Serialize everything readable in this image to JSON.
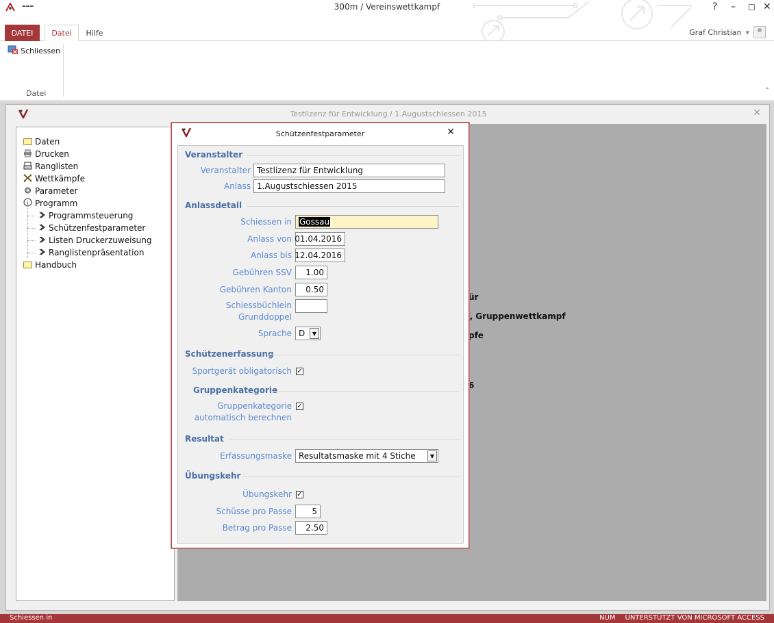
{
  "window": {
    "title": "300m / Vereinswettkampf",
    "help": "?",
    "minimize": "–",
    "restore": "☐",
    "close": "✕",
    "user": "Graf Christian",
    "user_dropdown": "▾"
  },
  "ribbon": {
    "tabs": [
      "DATEI",
      "Datei",
      "Hilfe"
    ],
    "button_label": "Schliessen",
    "group_label": "Datei",
    "collapse": "⌃"
  },
  "document": {
    "title": "Testlizenz für Entwicklung  /  1.Augustschiessen 2015",
    "close": "✕"
  },
  "tree": {
    "items": [
      {
        "label": "Daten",
        "icon": "folder-icon"
      },
      {
        "label": "Drucken",
        "icon": "printer-icon"
      },
      {
        "label": "Ranglisten",
        "icon": "list-icon"
      },
      {
        "label": "Wettkämpfe",
        "icon": "crossed-rifles-icon"
      },
      {
        "label": "Parameter",
        "icon": "gear-icon"
      },
      {
        "label": "Programm",
        "icon": "info-icon"
      },
      {
        "label": "Programmsteuerung",
        "icon": "chevron-right-icon"
      },
      {
        "label": "Schützenfestparameter",
        "icon": "chevron-right-icon"
      },
      {
        "label": "Listen Druckerzuweisung",
        "icon": "chevron-right-icon"
      },
      {
        "label": "Ranglistenpräsentation",
        "icon": "chevron-right-icon"
      },
      {
        "label": "Handbuch",
        "icon": "folder-icon"
      }
    ]
  },
  "background_text": [
    "ür",
    "f, Gruppenwettkampf",
    "pfe",
    "6"
  ],
  "dialog": {
    "title": "Schützenfestparameter",
    "close": "✕",
    "sections": {
      "veranstalter": "Veranstalter",
      "anlassdetail": "Anlassdetail",
      "schuetzenerfassung": "Schützenerfassung",
      "gruppenkategorie": "Gruppenkategorie",
      "resultat": "Resultat",
      "uebungskehr": "Übungskehr"
    },
    "fields": {
      "veranstalter_label": "Veranstalter",
      "veranstalter_value": "Testlizenz für Entwicklung",
      "anlass_label": "Anlass",
      "anlass_value": "1.Augustschiessen 2015",
      "schiessen_in_label": "Schiessen in",
      "schiessen_in_value": "Gossau",
      "anlass_von_label": "Anlass von",
      "anlass_von_value": "01.04.2016",
      "anlass_bis_label": "Anlass bis",
      "anlass_bis_value": "12.04.2016",
      "gebuehren_ssv_label": "Gebühren SSV",
      "gebuehren_ssv_value": "1.00",
      "gebuehren_kanton_label": "Gebühren Kanton",
      "gebuehren_kanton_value": "0.50",
      "schiessbuechlein_label_1": "Schiessbüchlein",
      "schiessbuechlein_label_2": "Grunddoppel",
      "schiessbuechlein_value": "",
      "sprache_label": "Sprache",
      "sprache_value": "D",
      "sportgeraet_label": "Sportgerät obligatorisch",
      "sportgeraet_checked": true,
      "gruppenkat_label_1": "Gruppenkategorie",
      "gruppenkat_label_2": "automatisch berechnen",
      "gruppenkat_checked": true,
      "erfassungsmaske_label": "Erfassungsmaske",
      "erfassungsmaske_value": "Resultatsmaske mit 4 Stiche",
      "uebungskehr_label": "Übungskehr",
      "uebungskehr_checked": true,
      "schuesse_label": "Schüsse pro Passe",
      "schuesse_value": "5",
      "betrag_label": "Betrag pro Passe",
      "betrag_value": "2.50"
    }
  },
  "status": {
    "left": "Schiessen in",
    "num": "NUM",
    "right": "UNTERSTÜTZT VON MICROSOFT ACCESS"
  },
  "colors": {
    "accent": "#a4373a",
    "label_blue": "#5b8ad0",
    "section_blue": "#4a6fa5",
    "content_gray": "#acacac"
  }
}
